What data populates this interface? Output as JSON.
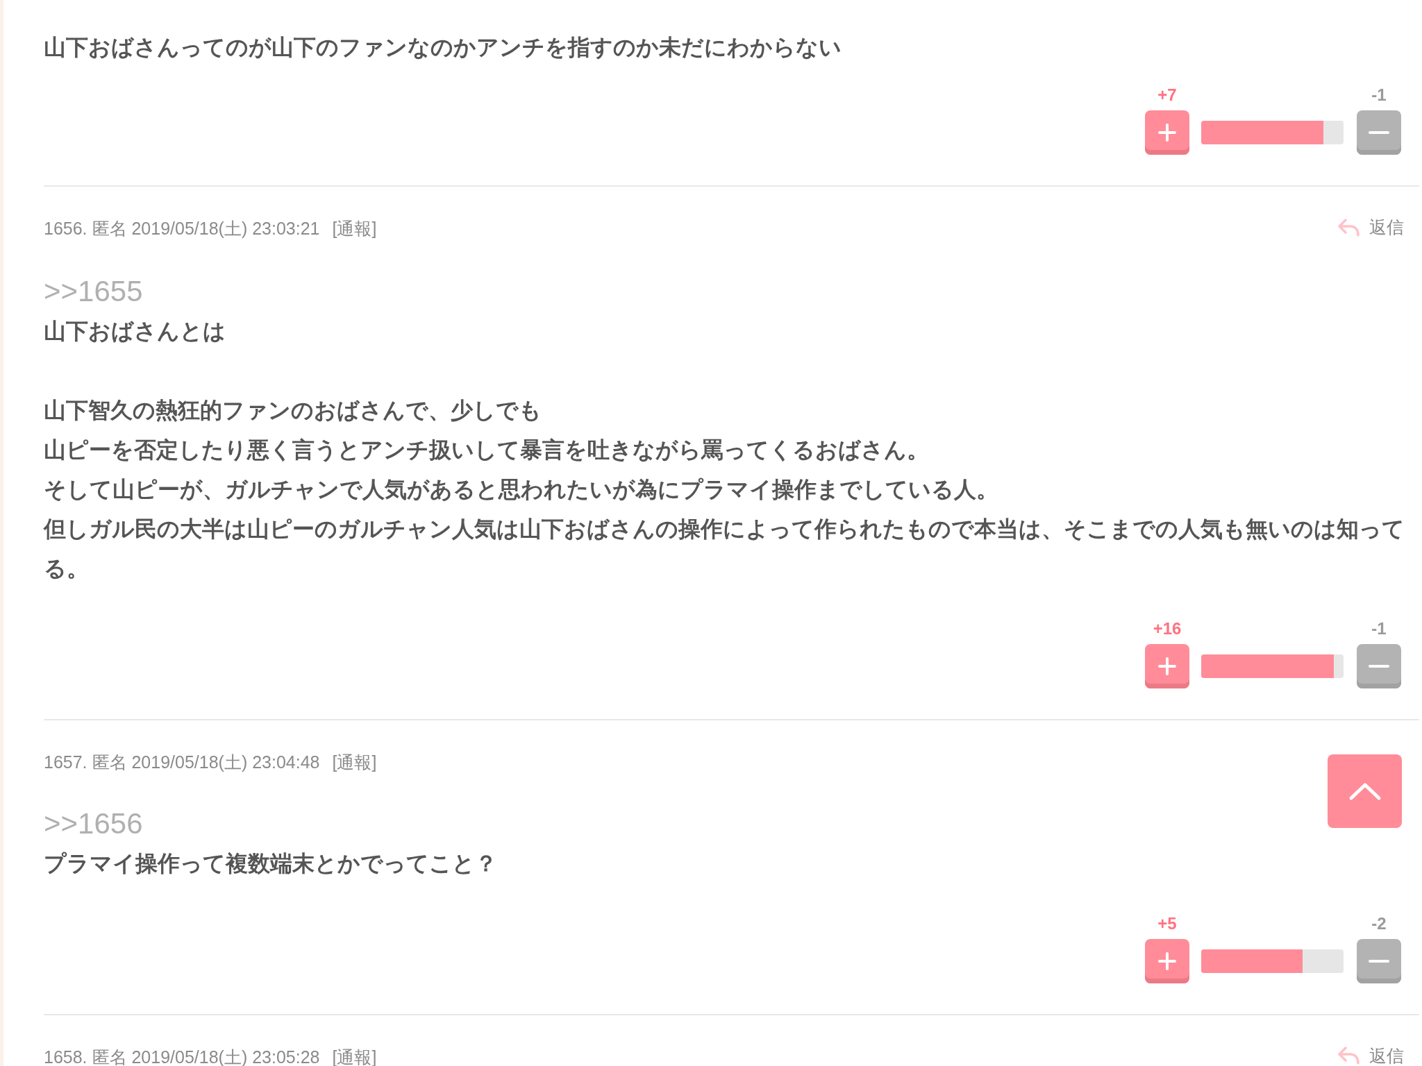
{
  "comments": [
    {
      "body": [
        [
          "山下おばさんってのが山下のファンなのかアンチを指すのか未だにわからない"
        ]
      ],
      "votes": {
        "plus": "+7",
        "minus": "-1",
        "level": 0.86
      }
    },
    {
      "header": "1656. 匿名 2019/05/18(土) 23:03:21",
      "report": "[通報]",
      "reply": "返信",
      "anchor": ">>1655",
      "body": [
        [
          "山下おばさんとは"
        ],
        [
          "山下智久の熱狂的ファンのおばさんで、少しでも",
          "山ピーを否定したり悪く言うとアンチ扱いして暴言を吐きながら罵ってくるおばさん。",
          "そして山ピーが、ガルチャンで人気があると思われたいが為にプラマイ操作までしている人。",
          "但しガル民の大半は山ピーのガルチャン人気は山下おばさんの操作によって作られたもので本当は、そこまでの人気も無いのは知ってる。"
        ]
      ],
      "votes": {
        "plus": "+16",
        "minus": "-1",
        "level": 0.93
      }
    },
    {
      "header": "1657. 匿名 2019/05/18(土) 23:04:48",
      "report": "[通報]",
      "anchor": ">>1656",
      "body": [
        [
          "プラマイ操作って複数端末とかでってこと？"
        ]
      ],
      "votes": {
        "plus": "+5",
        "minus": "-2",
        "level": 0.71
      }
    },
    {
      "header": "1658. 匿名 2019/05/18(土) 23:05:28",
      "report": "[通報]",
      "reply": "返信"
    }
  ]
}
